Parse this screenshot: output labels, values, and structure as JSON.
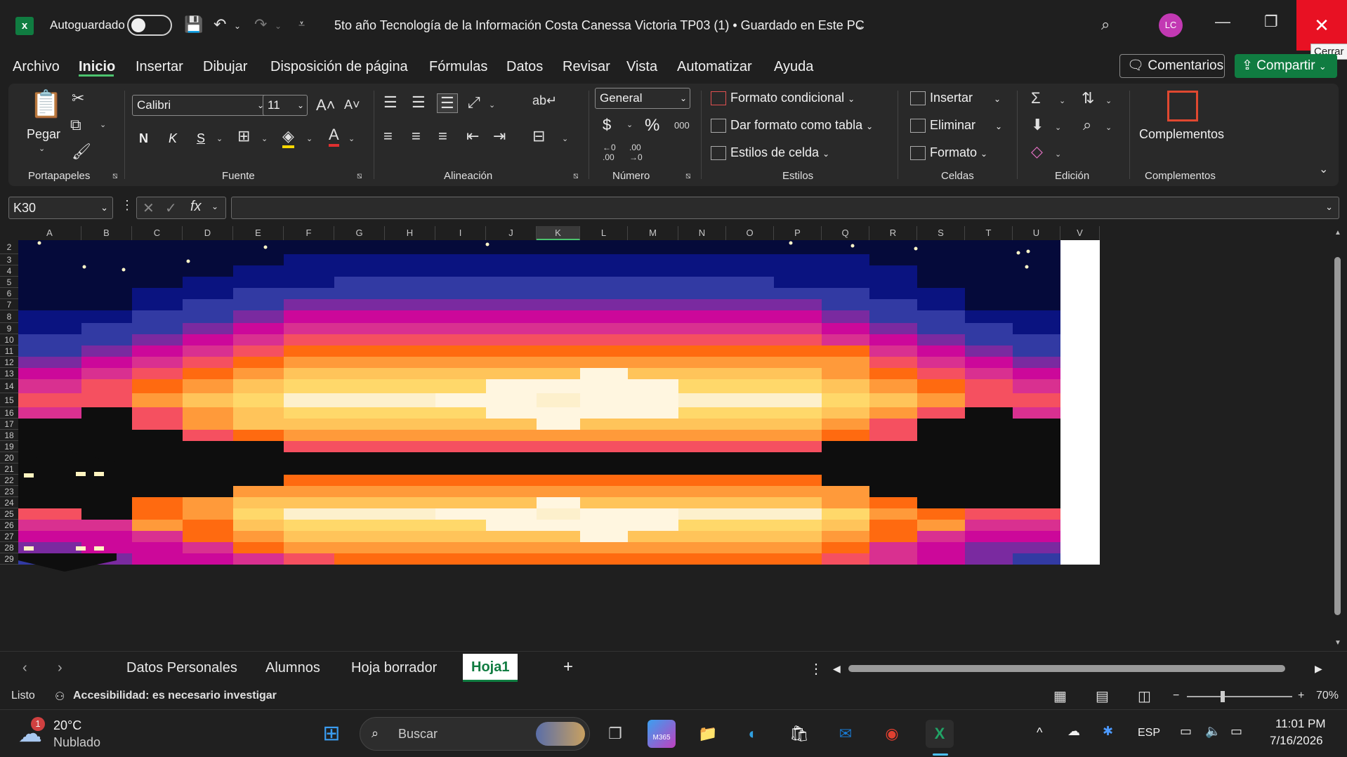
{
  "titlebar": {
    "autosave_label": "Autoguardado",
    "document_title": "5to año Tecnología de la Información Costa Canessa Victoria TP03 (1) • Guardado en Este PC",
    "avatar_initials": "LC",
    "close_tooltip": "Cerrar"
  },
  "menu": {
    "tabs": [
      "Archivo",
      "Inicio",
      "Insertar",
      "Dibujar",
      "Disposición de página",
      "Fórmulas",
      "Datos",
      "Revisar",
      "Vista",
      "Automatizar",
      "Ayuda"
    ],
    "comments_label": "Comentarios",
    "share_label": "Compartir"
  },
  "ribbon": {
    "paste_label": "Pegar",
    "clipboard_group": "Portapapeles",
    "font_name": "Calibri",
    "font_size": "11",
    "bold": "N",
    "italic": "K",
    "underline": "S",
    "font_group": "Fuente",
    "alignment_group": "Alineación",
    "number_format": "General",
    "currency": "$",
    "percent": "%",
    "thousands": "000",
    "number_group": "Número",
    "conditional_format": "Formato condicional",
    "format_as_table": "Dar formato como tabla",
    "cell_styles": "Estilos de celda",
    "styles_group": "Estilos",
    "insert": "Insertar",
    "delete": "Eliminar",
    "format": "Formato",
    "cells_group": "Celdas",
    "editing_group": "Edición",
    "addins_label": "Complementos",
    "addins_group": "Complementos"
  },
  "formula_bar": {
    "name_box": "K30",
    "formula": ""
  },
  "columns": [
    "A",
    "B",
    "C",
    "D",
    "E",
    "F",
    "G",
    "H",
    "I",
    "J",
    "K",
    "L",
    "M",
    "N",
    "O",
    "P",
    "Q",
    "R",
    "S",
    "T",
    "U",
    "V"
  ],
  "selected_column": "K",
  "rows": [
    "2",
    "3",
    "4",
    "5",
    "6",
    "7",
    "8",
    "9",
    "10",
    "11",
    "12",
    "13",
    "14",
    "15",
    "16",
    "17",
    "18",
    "19",
    "20",
    "21",
    "22",
    "23",
    "24",
    "25",
    "26",
    "27",
    "28",
    "29"
  ],
  "sheets": {
    "tabs": [
      "Datos Personales",
      "Alumnos",
      "Hoja borrador",
      "Hoja1"
    ],
    "active": "Hoja1"
  },
  "status": {
    "ready": "Listo",
    "accessibility": "Accesibilidad: es necesario investigar",
    "zoom": "70%"
  },
  "taskbar": {
    "temperature": "20°C",
    "weather": "Nublado",
    "weather_badge": "1",
    "search_placeholder": "Buscar",
    "language": "ESP",
    "time": "11:01 PM",
    "date": "7/16/2026",
    "m365_label": "M365"
  },
  "colors": {
    "excel_green": "#107c41",
    "accent_green": "#4cc36e",
    "close_red": "#e81123",
    "avatar": "#c239b3",
    "sky_night": "#050a3a",
    "sky_navy": "#0a1380",
    "sky_blue": "#323aa3",
    "violet": "#7a2aa0",
    "magenta": "#cc089a",
    "pink": "#d93090",
    "coral": "#f55060",
    "orange": "#ff6a10",
    "light_orange": "#ff9a3a",
    "gold": "#ffc45a",
    "yellow": "#ffd86a",
    "cream": "#fdf0cc",
    "white_sun": "#fff6e0",
    "silhouette": "#0e0e0e"
  }
}
